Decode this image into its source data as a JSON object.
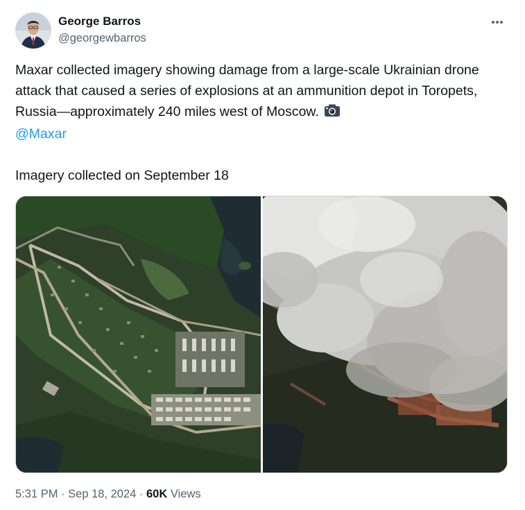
{
  "author": {
    "name": "George Barros",
    "handle": "@georgewbarros"
  },
  "tweet": {
    "body": "Maxar collected imagery showing damage from a large-scale Ukrainian drone attack that caused a series of explosions at an ammunition depot in Toropets, Russia—approximately 240 miles west of Moscow.",
    "emoji_icon": "camera-icon",
    "mention": "@Maxar",
    "caption": "Imagery collected on September 18"
  },
  "meta": {
    "time": "5:31 PM",
    "separator": "·",
    "date": "Sep 18, 2024",
    "views_count": "60K",
    "views_label": "Views"
  },
  "colors": {
    "link": "#1d9bf0",
    "secondary_text": "#536471",
    "primary_text": "#0f1419"
  }
}
